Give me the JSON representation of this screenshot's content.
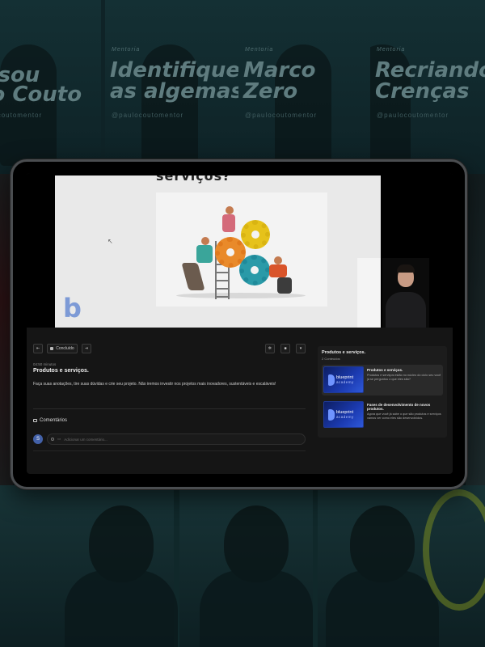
{
  "background": {
    "posters": [
      {
        "kicker": "",
        "lines": [
          "a, sou",
          "ulo Couto"
        ],
        "handle": "@paulocoutomentor"
      },
      {
        "kicker": "Mentoria",
        "lines": [
          "Identifique",
          "as algemas"
        ],
        "handle": "@paulocoutomentor"
      },
      {
        "kicker": "Mentoria",
        "lines": [
          "Marco",
          "Zero"
        ],
        "handle": "@paulocoutomentor"
      },
      {
        "kicker": "Mentoria",
        "lines": [
          "Recriando",
          "Crenças"
        ],
        "handle": "@paulocoutomentor"
      }
    ]
  },
  "video": {
    "slide_title": "serviços?",
    "logo_letter": "b"
  },
  "controls": {
    "prev_label": "⇤",
    "done_label": "Concluído",
    "next_label": "⇥"
  },
  "lesson": {
    "meta": "04:50 minutos",
    "title": "Produtos e serviços.",
    "description": "Faça suas anotações, tire suas dúvidas e crie seu projeto. Não iremos investir nos projetos mais inovadores, sustentáveis e escaláveis!"
  },
  "comments": {
    "heading": "Comentários",
    "avatar_initial": "S",
    "placeholder": "Adicionar um comentário..."
  },
  "sidebar": {
    "title": "Produtos e serviços.",
    "count": "2 Conteúdos",
    "items": [
      {
        "brand": "blueprint",
        "brand_sub": "academy",
        "title": "Produtos e serviços.",
        "description": "Produtos e serviços estão no núcleo do ciclo seu você já se perguntou o que eles são?"
      },
      {
        "brand": "blueprint",
        "brand_sub": "academy",
        "title": "Fases de desenvolvimento de novos produtos.",
        "description": "Agora que você já sabe o que são produtos e serviços vamos ver como eles são desenvolvidos."
      }
    ]
  },
  "colors": {
    "accent": "#1b3ab0",
    "avatar": "#4361a8",
    "screen_bg": "#151515"
  }
}
